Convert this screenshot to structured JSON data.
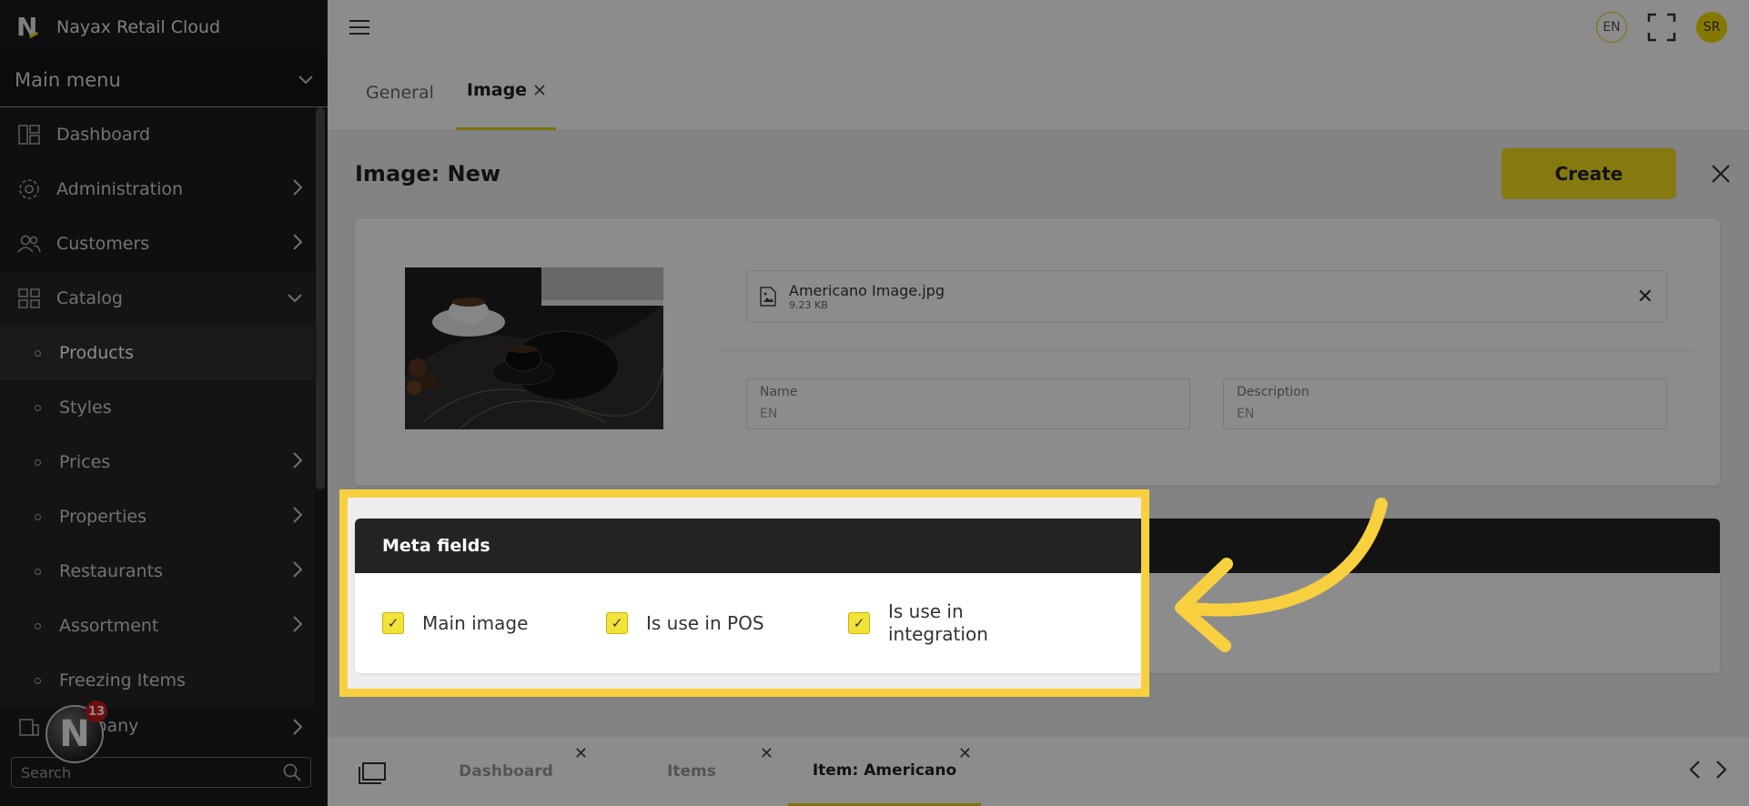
{
  "app": {
    "name": "Nayax Retail Cloud"
  },
  "sidebar": {
    "main_menu": "Main menu",
    "items": [
      {
        "label": "Dashboard"
      },
      {
        "label": "Administration"
      },
      {
        "label": "Customers"
      },
      {
        "label": "Catalog"
      },
      {
        "label": "Products"
      },
      {
        "label": "Styles"
      },
      {
        "label": "Prices"
      },
      {
        "label": "Properties"
      },
      {
        "label": "Restaurants"
      },
      {
        "label": "Assortment"
      },
      {
        "label": "Freezing Items"
      },
      {
        "label": "Company"
      }
    ],
    "search_placeholder": "Search",
    "notification_count": "13"
  },
  "topbar": {
    "language": "EN",
    "user_initials": "SR"
  },
  "tabs": [
    {
      "label": "General"
    },
    {
      "label": "Image"
    }
  ],
  "page": {
    "title": "Image: New",
    "create_label": "Create"
  },
  "file": {
    "name": "Americano Image.jpg",
    "size": "9.23 KB"
  },
  "fields": {
    "name_label": "Name",
    "name_lang": "EN",
    "description_label": "Description",
    "description_lang": "EN"
  },
  "meta": {
    "title": "Meta fields",
    "checkboxes": [
      {
        "label": "Main image"
      },
      {
        "label": "Is use in POS"
      },
      {
        "label": "Is use in integration"
      }
    ]
  },
  "bottom_tabs": [
    {
      "label": "Dashboard"
    },
    {
      "label": "Items"
    },
    {
      "label": "Item: Americano"
    }
  ],
  "colors": {
    "accent": "#f2dc1e",
    "highlight": "#f8d03f",
    "sidebar": "#1d1d1d"
  }
}
